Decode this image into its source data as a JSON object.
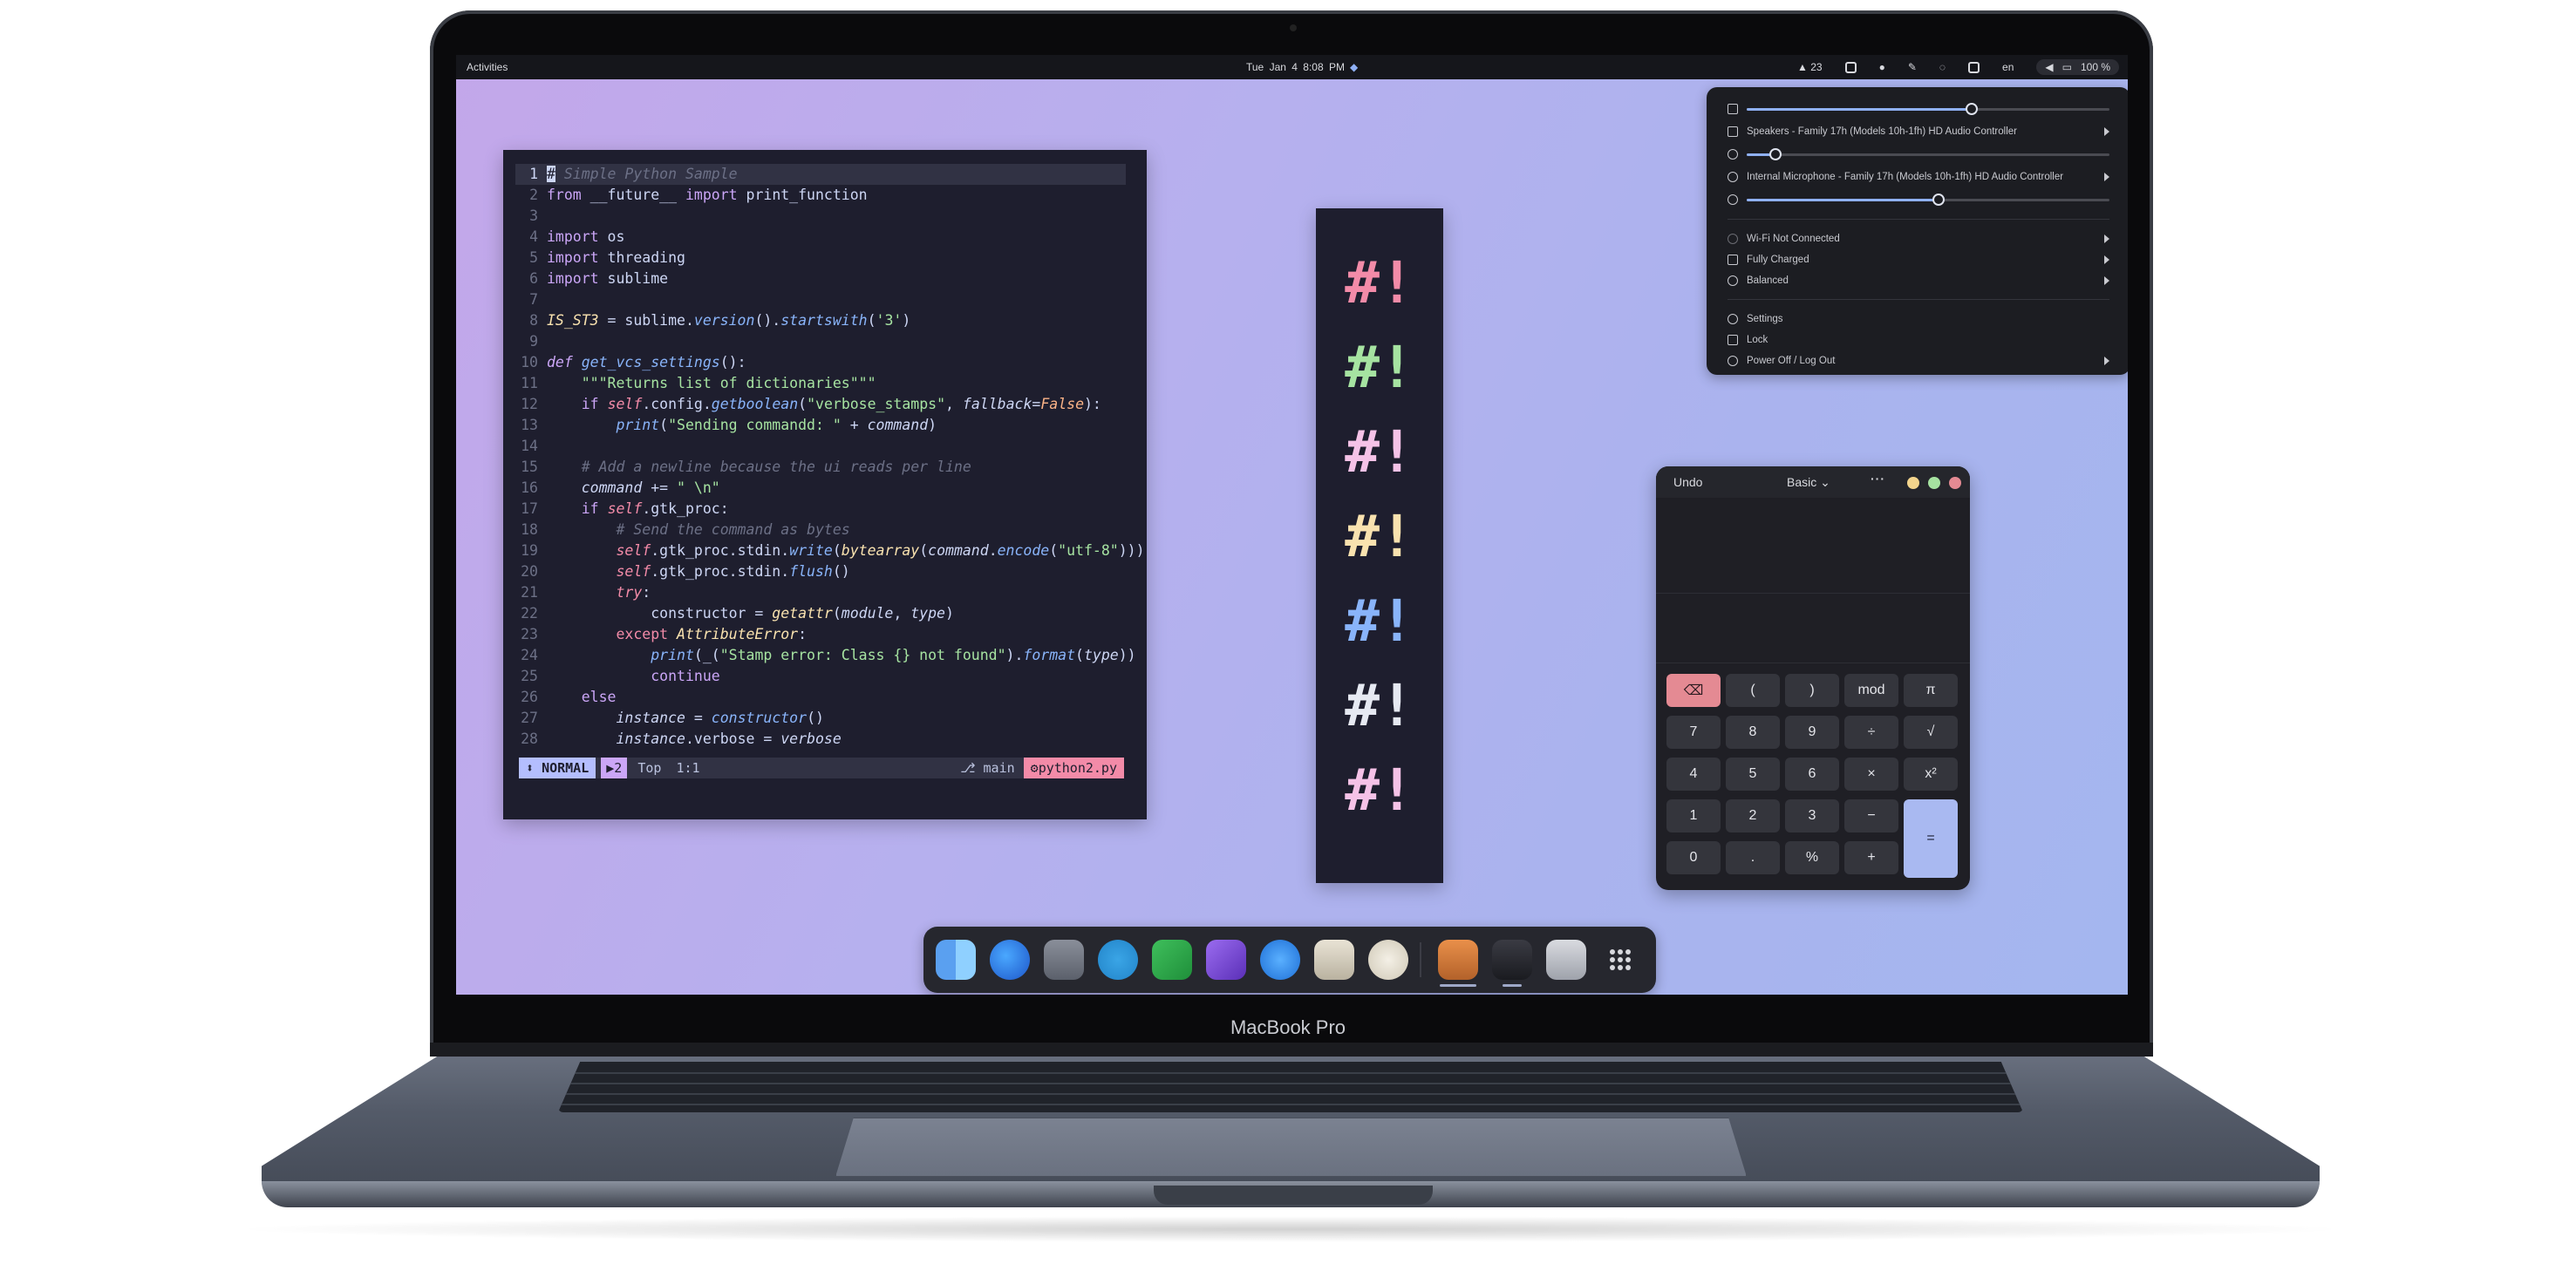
{
  "laptop": {
    "model_label": "MacBook Pro"
  },
  "topbar": {
    "activities": "Activities",
    "date": "Tue Jan 4",
    "time": "8:08 PM",
    "tray_count": "23",
    "lang": "en",
    "battery": "100 %"
  },
  "editor": {
    "lines": [
      {
        "n": "1",
        "html": "<span class='cur-block'>#</span><span class='cm'> Simple Python Sample</span>"
      },
      {
        "n": "2",
        "html": "<span class='kw'>from</span> __future__ <span class='kw'>import</span> print_function"
      },
      {
        "n": "3",
        "html": ""
      },
      {
        "n": "4",
        "html": "<span class='kw'>import</span> os"
      },
      {
        "n": "5",
        "html": "<span class='kw'>import</span> threading"
      },
      {
        "n": "6",
        "html": "<span class='kw'>import</span> sublime"
      },
      {
        "n": "7",
        "html": ""
      },
      {
        "n": "8",
        "html": "<span class='bi'>IS_ST3</span> = sublime.<span class='fn'>version</span>().<span class='fn'>startswith</span>(<span class='st'>'3'</span>)"
      },
      {
        "n": "9",
        "html": ""
      },
      {
        "n": "10",
        "html": "<span class='kwi'>def</span> <span class='fn'>get_vcs_settings</span>():"
      },
      {
        "n": "11",
        "html": "    <span class='st'>\"\"\"Returns list of dictionaries\"\"\"</span>"
      },
      {
        "n": "12",
        "html": "    <span class='kw'>if</span> <span class='sf'>self</span>.config.<span class='fn'>getboolean</span>(<span class='st'>\"verbose_stamps\"</span>, <span class='it'>fallback</span>=<span class='nm'>False</span>):"
      },
      {
        "n": "13",
        "html": "        <span class='fn'>print</span>(<span class='st'>\"Sending commandd: \"</span> + <span class='it'>command</span>)"
      },
      {
        "n": "14",
        "html": ""
      },
      {
        "n": "15",
        "html": "    <span class='cm'># Add a newline because the ui reads per line</span>"
      },
      {
        "n": "16",
        "html": "    <span class='it'>command</span> += <span class='st'>\" \\n\"</span>"
      },
      {
        "n": "17",
        "html": "    <span class='kw'>if</span> <span class='sf'>self</span>.gtk_proc:"
      },
      {
        "n": "18",
        "html": "        <span class='cm'># Send the command as bytes</span>"
      },
      {
        "n": "19",
        "html": "        <span class='sf'>self</span>.gtk_proc.stdin.<span class='fn'>write</span>(<span class='bi'>bytearray</span>(<span class='it'>command</span>.<span class='fn'>encode</span>(<span class='st'>\"utf-8\"</span>)))"
      },
      {
        "n": "20",
        "html": "        <span class='sf'>self</span>.gtk_proc.stdin.<span class='fn'>flush</span>()"
      },
      {
        "n": "21",
        "html": "        <span class='kwi' style='color:#f38ba8'>try</span>:"
      },
      {
        "n": "22",
        "html": "            constructor = <span class='bi'>getattr</span>(<span class='it'>module</span>, <span class='it'>type</span>)"
      },
      {
        "n": "23",
        "html": "        <span class='kw' style='color:#f38ba8'>except</span> <span class='bi'>AttributeError</span>:"
      },
      {
        "n": "24",
        "html": "            <span class='fn'>print</span>(_(<span class='st'>\"Stamp error: Class {} not found\"</span>).<span class='fn'>format</span>(<span class='it'>type</span>))"
      },
      {
        "n": "25",
        "html": "            <span class='kw'>continue</span>"
      },
      {
        "n": "26",
        "html": "    <span class='kw'>else</span>"
      },
      {
        "n": "27",
        "html": "        <span class='it'>instance</span> = <span class='fn'>constructor</span>()"
      },
      {
        "n": "28",
        "html": "        <span class='it'>instance</span>.verbose = <span class='it'>verbose</span>"
      }
    ],
    "status": {
      "mode": "NORMAL",
      "buffers": "2",
      "position": "Top",
      "cursor": "1:1",
      "branch": "main",
      "file": "python2.py"
    }
  },
  "hash_panel": {
    "glyph": "#!",
    "colors": [
      "#f38ba8",
      "#a6e3a1",
      "#f5c2e7",
      "#f9e2af",
      "#89b4fa",
      "#e6e9f2",
      "#f5c2e7"
    ]
  },
  "quick_settings": {
    "volume_level": 0.62,
    "output_device": "Speakers - Family 17h (Models 10h-1fh) HD Audio Controller",
    "mic_level": 0.08,
    "input_device": "Internal Microphone - Family 17h (Models 10h-1fh) HD Audio Controller",
    "brightness_level": 0.53,
    "wifi": "Wi-Fi Not Connected",
    "battery": "Fully Charged",
    "power_mode": "Balanced",
    "settings": "Settings",
    "lock": "Lock",
    "power": "Power Off / Log Out"
  },
  "calculator": {
    "undo": "Undo",
    "mode": "Basic",
    "more": "···",
    "keys": [
      "⌫",
      "(",
      ")",
      "mod",
      "π",
      "7",
      "8",
      "9",
      "÷",
      "√",
      "4",
      "5",
      "6",
      "×",
      "x²",
      "1",
      "2",
      "3",
      "−",
      "=",
      "0",
      ".",
      "%",
      "+"
    ],
    "colors": {
      "backspace": "#e48a93",
      "equals": "#a9b9f1",
      "minimize": "#f4d58d",
      "maximize": "#a6e3a1",
      "close": "#e48a93"
    }
  },
  "dock": {
    "apps": [
      "finder-icon",
      "firefox-icon",
      "scanner-icon",
      "telegram-icon",
      "n-app-icon",
      "obsidian-icon",
      "safari-icon",
      "camera-icon",
      "egg-icon",
      "calculator-icon",
      "terminal-icon",
      "trash-icon",
      "app-grid-icon"
    ]
  }
}
